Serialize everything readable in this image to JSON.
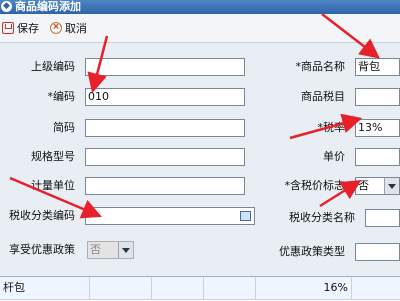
{
  "window": {
    "title": "商品编码添加"
  },
  "toolbar": {
    "save_label": "保存",
    "cancel_label": "取消"
  },
  "form": {
    "parent_code": {
      "label": "上级编码",
      "value": ""
    },
    "code": {
      "label": "*编码",
      "value": "010"
    },
    "short_code": {
      "label": "简码",
      "value": ""
    },
    "spec_model": {
      "label": "规格型号",
      "value": ""
    },
    "unit": {
      "label": "计量单位",
      "value": ""
    },
    "tax_category_code": {
      "label": "税收分类编码",
      "value": ""
    },
    "preferential_policy": {
      "label": "享受优惠政策",
      "value": "否"
    },
    "product_name": {
      "label": "*商品名称",
      "value": "背包"
    },
    "product_tax_item": {
      "label": "商品税目",
      "value": ""
    },
    "tax_rate": {
      "label": "*税率",
      "value": "13%"
    },
    "unit_price": {
      "label": "单价",
      "value": ""
    },
    "tax_included_flag": {
      "label": "*含税价标志",
      "value": "否"
    },
    "tax_category_name": {
      "label": "税收分类名称",
      "value": ""
    },
    "preferential_policy_type": {
      "label": "优惠政策类型",
      "value": ""
    }
  },
  "grid": {
    "rows": [
      {
        "name": "杆包",
        "rate": "16%"
      }
    ]
  },
  "colors": {
    "annotation_arrow": "#e8202a",
    "title_bar": "#2f63a6"
  },
  "icons": [
    "save-icon",
    "cancel-icon",
    "tax-code-picker-icon",
    "dropdown-arrow-icon"
  ]
}
